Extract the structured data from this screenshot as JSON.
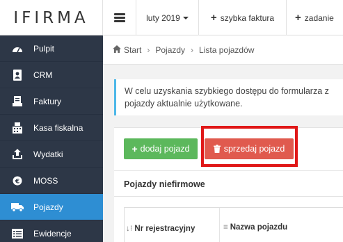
{
  "topbar": {
    "logo": "IFIRMA",
    "month": "luty 2019",
    "quick_invoice": "szybka faktura",
    "task": "zadanie"
  },
  "sidebar": {
    "items": [
      {
        "label": "Pulpit",
        "icon": "dashboard-icon"
      },
      {
        "label": "CRM",
        "icon": "address-book-icon"
      },
      {
        "label": "Faktury",
        "icon": "invoice-icon"
      },
      {
        "label": "Kasa fiskalna",
        "icon": "cash-register-icon"
      },
      {
        "label": "Wydatki",
        "icon": "upload-icon"
      },
      {
        "label": "MOSS",
        "icon": "euro-icon"
      },
      {
        "label": "Pojazdy",
        "icon": "truck-icon",
        "active": true
      },
      {
        "label": "Ewidencje",
        "icon": "list-icon"
      }
    ],
    "active_color": "#2e8ed3"
  },
  "breadcrumb": {
    "items": [
      "Start",
      "Pojazdy",
      "Lista pojazdów"
    ]
  },
  "info": {
    "line1": "W celu uzyskania szybkiego dostępu do formularza z",
    "line2": "pojazdy aktualnie użytkowane."
  },
  "actions": {
    "add_label": "dodaj pojazd",
    "sell_label": "sprzedaj pojazd"
  },
  "section": {
    "title": "Pojazdy niefirmowe"
  },
  "table": {
    "columns": [
      "Nr rejestracyjny",
      "Nazwa pojazdu"
    ]
  }
}
